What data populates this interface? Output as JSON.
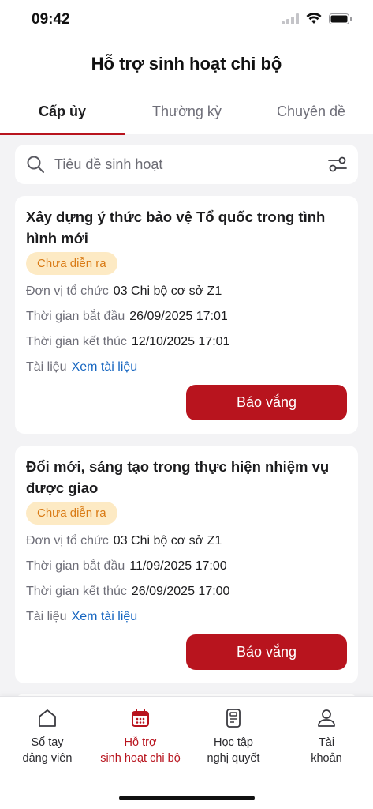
{
  "status_bar": {
    "time": "09:42"
  },
  "header": {
    "title": "Hỗ trợ sinh hoạt chi bộ"
  },
  "tabs": [
    {
      "label": "Cấp ủy",
      "active": true
    },
    {
      "label": "Thường kỳ",
      "active": false
    },
    {
      "label": "Chuyên đề",
      "active": false
    }
  ],
  "search": {
    "placeholder": "Tiêu đề sinh hoạt",
    "value": ""
  },
  "cards": [
    {
      "title": "Xây dựng ý thức bảo vệ Tổ quốc trong tình hình mới",
      "status": "Chưa diễn ra",
      "unit_label": "Đơn vị tổ chức",
      "unit_value": "03 Chi bộ cơ sở Z1",
      "start_label": "Thời gian bắt đầu",
      "start_value": "26/09/2025 17:01",
      "end_label": "Thời gian kết thúc",
      "end_value": "12/10/2025 17:01",
      "doc_label": "Tài liệu",
      "doc_link": "Xem tài liệu",
      "button": "Báo vắng"
    },
    {
      "title": "Đổi mới, sáng tạo trong thực hiện nhiệm vụ được giao",
      "status": "Chưa diễn ra",
      "unit_label": "Đơn vị tổ chức",
      "unit_value": "03 Chi bộ cơ sở Z1",
      "start_label": "Thời gian bắt đầu",
      "start_value": "11/09/2025 17:00",
      "end_label": "Thời gian kết thúc",
      "end_value": "26/09/2025 17:00",
      "doc_label": "Tài liệu",
      "doc_link": "Xem tài liệu",
      "button": "Báo vắng"
    }
  ],
  "bottom_nav": [
    {
      "line1": "Sổ tay",
      "line2": "đảng viên",
      "icon": "home-icon",
      "active": false
    },
    {
      "line1": "Hỗ trợ",
      "line2": "sinh hoạt chi bộ",
      "icon": "calendar-icon",
      "active": true
    },
    {
      "line1": "Học tập",
      "line2": "nghị quyết",
      "icon": "document-icon",
      "active": false
    },
    {
      "line1": "Tài",
      "line2": "khoản",
      "icon": "user-icon",
      "active": false
    }
  ],
  "colors": {
    "accent": "#b8141e",
    "badge_bg": "#fdeac4",
    "badge_text": "#d97a14",
    "link": "#1565c0",
    "background": "#f3f3f5"
  }
}
